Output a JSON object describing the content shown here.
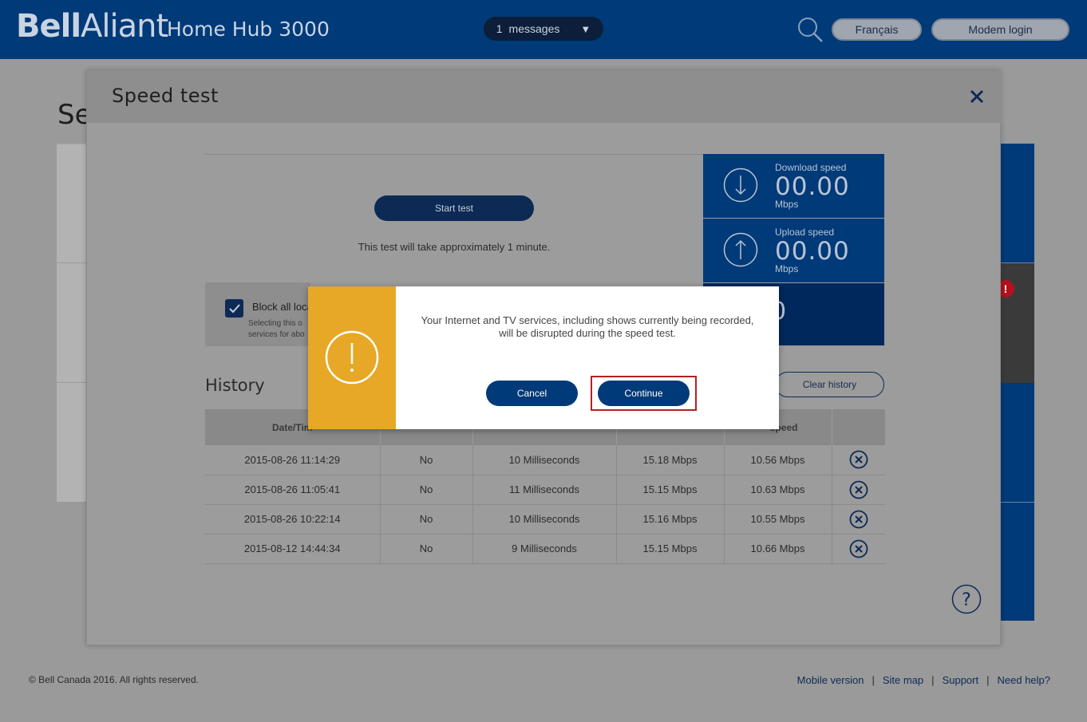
{
  "header": {
    "brand_bold": "Bell",
    "brand_light": "Aliant",
    "product": "Home Hub 3000",
    "messages_count": "1",
    "messages_label": "messages",
    "language_button": "Français",
    "modem_login_button": "Modem login"
  },
  "background": {
    "page_title": "Se"
  },
  "modal": {
    "title": "Speed test",
    "start_button": "Start test",
    "test_note": "This test will take approximately 1 minute.",
    "block_label": "Block all loca",
    "block_desc_line1": "Selecting this o",
    "block_desc_line2": "services for abo",
    "download": {
      "label": "Download speed",
      "value": "00.00",
      "unit": "Mbps"
    },
    "upload": {
      "label": "Upload speed",
      "value": "00.00",
      "unit": "Mbps"
    },
    "ping_partial": "0",
    "history_title": "History",
    "clear_history": "Clear history",
    "table": {
      "headers": [
        "Date/Tim",
        "",
        "",
        "",
        "speed",
        ""
      ],
      "rows": [
        [
          "2015-08-26 11:14:29",
          "No",
          "10 Milliseconds",
          "15.18 Mbps",
          "10.56 Mbps"
        ],
        [
          "2015-08-26 11:05:41",
          "No",
          "11 Milliseconds",
          "15.15 Mbps",
          "10.63 Mbps"
        ],
        [
          "2015-08-26 10:22:14",
          "No",
          "10 Milliseconds",
          "15.16 Mbps",
          "10.55 Mbps"
        ],
        [
          "2015-08-12 14:44:34",
          "No",
          "9 Milliseconds",
          "15.15 Mbps",
          "10.66 Mbps"
        ]
      ]
    }
  },
  "dialog": {
    "message_line1": "Your Internet and TV services, including shows currently being recorded,",
    "message_line2": "will be disrupted during the speed test.",
    "cancel_button": "Cancel",
    "continue_button": "Continue"
  },
  "footer": {
    "copyright": "© Bell Canada 2016. All rights reserved.",
    "links": [
      "Mobile version",
      "Site map",
      "Support",
      "Need help?"
    ]
  },
  "colors": {
    "brand_blue": "#003a78",
    "dark_navy": "#0d2a55",
    "warning_orange": "#e6a826",
    "highlight_red": "#b32020"
  }
}
